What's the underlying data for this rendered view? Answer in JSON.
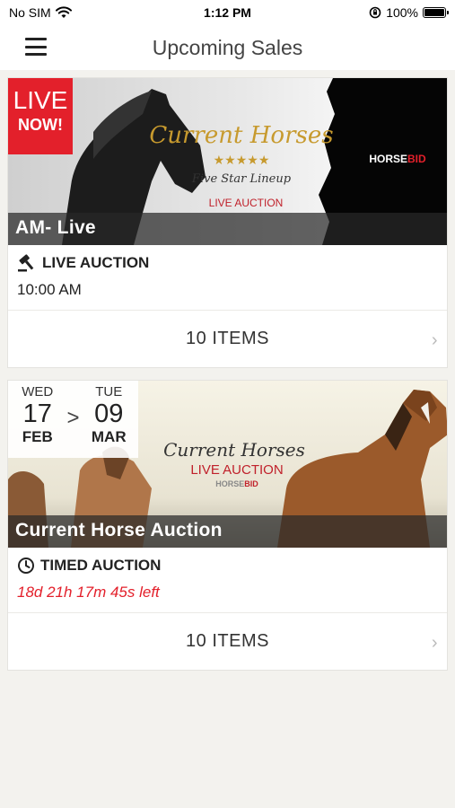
{
  "status_bar": {
    "carrier": "No SIM",
    "time": "1:12 PM",
    "battery": "100%"
  },
  "nav": {
    "title": "Upcoming Sales"
  },
  "sales": [
    {
      "live_badge": {
        "line1": "LIVE",
        "line2": "NOW!"
      },
      "banner_title": "Current Horses",
      "banner_subtitle": "Five Star Lineup",
      "banner_tag": "LIVE AUCTION",
      "brand": "HORSEBID",
      "name": "AM- Live",
      "type": "LIVE AUCTION",
      "when": "10:00 AM",
      "items": "10 ITEMS"
    },
    {
      "start": {
        "dow": "WED",
        "day": "17",
        "mon": "FEB"
      },
      "end": {
        "dow": "TUE",
        "day": "09",
        "mon": "MAR"
      },
      "banner_title": "Current Horses",
      "banner_tag": "LIVE AUCTION",
      "brand": "HORSEBID",
      "name": "Current Horse Auction",
      "type": "TIMED AUCTION",
      "when": "18d 21h 17m 45s left",
      "items": "10 ITEMS"
    }
  ],
  "colors": {
    "accent_red": "#e3202b"
  }
}
